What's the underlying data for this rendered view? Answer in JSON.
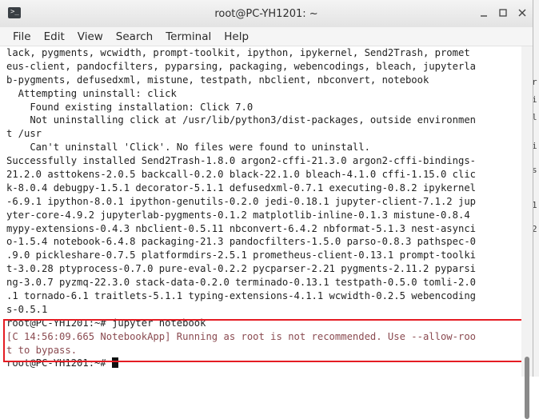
{
  "window": {
    "title": "root@PC-YH1201: ~",
    "controls": [
      "minimize",
      "maximize",
      "close"
    ]
  },
  "menu": [
    "File",
    "Edit",
    "View",
    "Search",
    "Terminal",
    "Help"
  ],
  "terminal": {
    "lines": [
      "lack, pygments, wcwidth, prompt-toolkit, ipython, ipykernel, Send2Trash, promet",
      "eus-client, pandocfilters, pyparsing, packaging, webencodings, bleach, jupyterla",
      "b-pygments, defusedxml, mistune, testpath, nbclient, nbconvert, notebook",
      "  Attempting uninstall: click",
      "    Found existing installation: Click 7.0",
      "    Not uninstalling click at /usr/lib/python3/dist-packages, outside environmen",
      "t /usr",
      "    Can't uninstall 'Click'. No files were found to uninstall.",
      "Successfully installed Send2Trash-1.8.0 argon2-cffi-21.3.0 argon2-cffi-bindings-",
      "21.2.0 asttokens-2.0.5 backcall-0.2.0 black-22.1.0 bleach-4.1.0 cffi-1.15.0 clic",
      "k-8.0.4 debugpy-1.5.1 decorator-5.1.1 defusedxml-0.7.1 executing-0.8.2 ipykernel",
      "-6.9.1 ipython-8.0.1 ipython-genutils-0.2.0 jedi-0.18.1 jupyter-client-7.1.2 jup",
      "yter-core-4.9.2 jupyterlab-pygments-0.1.2 matplotlib-inline-0.1.3 mistune-0.8.4",
      "mypy-extensions-0.4.3 nbclient-0.5.11 nbconvert-6.4.2 nbformat-5.1.3 nest-asynci",
      "o-1.5.4 notebook-6.4.8 packaging-21.3 pandocfilters-1.5.0 parso-0.8.3 pathspec-0",
      ".9.0 pickleshare-0.7.5 platformdirs-2.5.1 prometheus-client-0.13.1 prompt-toolki",
      "t-3.0.28 ptyprocess-0.7.0 pure-eval-0.2.2 pycparser-2.21 pygments-2.11.2 pyparsi",
      "ng-3.0.7 pyzmq-22.3.0 stack-data-0.2.0 terminado-0.13.1 testpath-0.5.0 tomli-2.0",
      ".1 tornado-6.1 traitlets-5.1.1 typing-extensions-4.1.1 wcwidth-0.2.5 webencoding",
      "s-0.5.1"
    ],
    "command_line": "root@PC-YH1201:~# jupyter notebook",
    "warning_lines": [
      "[C 14:56:09.665 NotebookApp] Running as root is not recommended. Use --allow-roo",
      "t to bypass."
    ],
    "prompt_line": "root@PC-YH1201:~# "
  },
  "backdrop_text": [
    "r",
    "i",
    "l",
    "i",
    "s",
    "1",
    "2"
  ],
  "colors": {
    "highlight_border": "#e51c23",
    "warning_text": "#8a4a50"
  }
}
